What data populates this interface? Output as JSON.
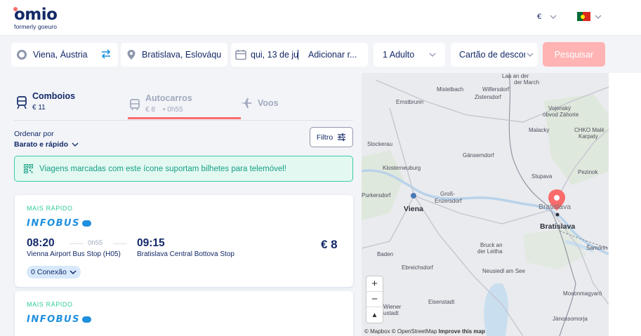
{
  "header": {
    "logo": "omio",
    "logo_sub": "formerly goeuro",
    "currency": "€",
    "colors": {
      "brand": "#132968",
      "accent": "#fa6b6b"
    }
  },
  "search": {
    "from": "Viena, Áustria",
    "to": "Bratislava, Eslováqu",
    "date": "qui, 13 de jur",
    "return": "Adicionar r...",
    "passengers": "1 Adulto",
    "discount": "Cartão de descon",
    "submit": "Pesquisar"
  },
  "tabs": [
    {
      "label": "Comboios",
      "sub": "€ 11",
      "icon": "train-icon"
    },
    {
      "label": "Autocarros",
      "sub": "€ 8",
      "sub2": "• 0h55",
      "icon": "bus-icon"
    },
    {
      "label": "Voos",
      "icon": "plane-icon"
    }
  ],
  "sort": {
    "label": "Ordenar por",
    "value": "Barato e rápido"
  },
  "filter": {
    "label": "Filtro"
  },
  "banner": {
    "text": "Viagens marcadas com este ícone suportam bilhetes para telemóvel!"
  },
  "results": [
    {
      "badge": "MAIS RÁPIDO",
      "carrier": "INFOBUS",
      "departure": "08:20",
      "arrival": "09:15",
      "duration": "0h55",
      "departure_station": "Vienna Airport Bus Stop (H05)",
      "arrival_station": "Bratislava Central Bottova Stop",
      "price": "€ 8",
      "connections": "0 Conexão"
    },
    {
      "badge": "MAIS RÁPIDO",
      "carrier": "INFOBUS"
    }
  ],
  "map": {
    "labels": {
      "mistelbach": "Mistelbach",
      "wilfersdorf": "Wilfersdorf",
      "ernstbrunn": "Ernstbrunn",
      "zistersdorf": "Zistersdorf",
      "laa": "Laa an der",
      "march": "der March",
      "vojensky": "Vojenský",
      "obvod": "obvod Záhorie",
      "malacky": "Malacky",
      "chko1": "CHKO Malé",
      "chko2": "Karpaty",
      "stockerau": "Stockerau",
      "gansendorf": "Gänserndorf",
      "klosterneuburg": "Klosterneuburg",
      "stupava": "Stupava",
      "pezinok": "Pezinok",
      "purkersdorf": "Purkersdorf",
      "gross1": "Groß-",
      "gross2": "Enzersdorf",
      "viena": "Viena",
      "bratislava_top": "Bratislava",
      "bratislava": "Bratislava",
      "bruck1": "Bruck an",
      "bruck2": "der Leitha",
      "baden": "Baden",
      "ebreichsdorf": "Ebreichsdorf",
      "samorin": "Šamorín",
      "neusiedl": "Neusiedl am See",
      "mosonmagyarovar": "Mosonmagyaró",
      "eisenstadt": "Eisenstadt",
      "wiener1": "Wiener",
      "wiener2": "ustadt",
      "jonossomorja": "Jánossomorja"
    },
    "zoom_in": "+",
    "zoom_out": "−",
    "compass": "▲",
    "attribution_1": "© Mapbox © OpenStreetMap",
    "attribution_2": "Improve this map"
  }
}
